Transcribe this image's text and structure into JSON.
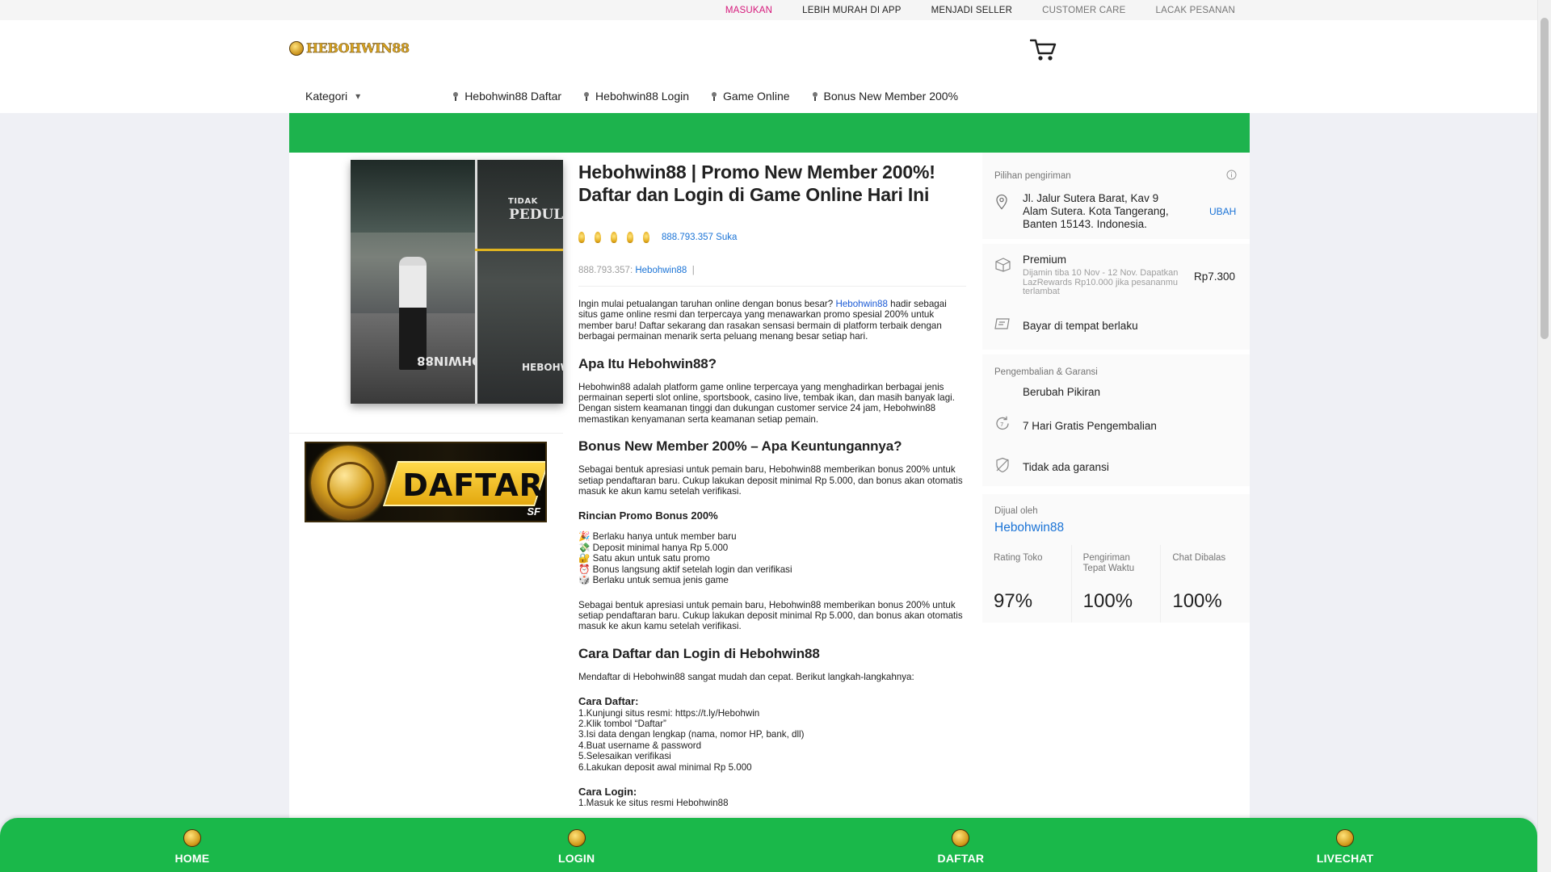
{
  "topbar": {
    "links": [
      {
        "label": "MASUKAN",
        "color": "#d6187b"
      },
      {
        "label": "LEBIH MURAH DI APP",
        "color": "#212121"
      },
      {
        "label": "MENJADI SELLER",
        "color": "#212121"
      },
      {
        "label": "CUSTOMER CARE",
        "color": "#757575"
      },
      {
        "label": "LACAK PESANAN",
        "color": "#757575"
      }
    ]
  },
  "header": {
    "logo_text": "HEBOHWIN88",
    "cart_icon": "cart-icon"
  },
  "nav": {
    "kategori": "Kategori",
    "items": [
      "Hebohwin88 Daftar",
      "Hebohwin88 Login",
      "Game Online",
      "Bonus New Member 200%"
    ]
  },
  "gallery": {
    "image_text_1": "TIDAK",
    "image_text_2": "PEDULI",
    "watermark": "HEBOHWIN88",
    "banner_label": "DAFTAR",
    "banner_corner": "SF"
  },
  "product": {
    "title_line1": "Hebohwin88 | Promo New Member 200%!",
    "title_line2": "Daftar dan Login di Game Online Hari Ini",
    "rating_stars": 5,
    "likes": "888.793.357 Suka",
    "byline_count": "888.793.357:",
    "byline_brand": "Hebohwin88",
    "byline_sep": "|",
    "intro_before": "Ingin mulai petualangan taruhan online dengan bonus besar?",
    "intro_link": "Hebohwin88",
    "intro_after": "hadir sebagai situs game online resmi dan terpercaya yang menawarkan promo spesial 200% untuk member baru! Daftar sekarang dan rasakan sensasi bermain di platform terbaik dengan berbagai permainan menarik serta peluang menang besar setiap hari.",
    "h_apa": "Apa Itu Hebohwin88?",
    "p_apa": "Hebohwin88 adalah platform game online terpercaya yang menghadirkan berbagai jenis permainan seperti slot online, sportsbook, casino live, tembak ikan, dan masih banyak lagi. Dengan sistem keamanan tinggi dan dukungan customer service 24 jam, Hebohwin88 memastikan kenyamanan serta keamanan setiap pemain.",
    "h_bonus": "Bonus New Member 200% – Apa Keuntungannya?",
    "p_bonus": "Sebagai bentuk apresiasi untuk pemain baru, Hebohwin88 memberikan bonus 200% untuk setiap pendaftaran baru. Cukup lakukan deposit minimal Rp 5.000, dan bonus akan otomatis masuk ke akun kamu setelah verifikasi.",
    "h_rincian": "Rincian Promo Bonus 200%",
    "rincian": [
      {
        "icon": "🎉",
        "text": "Berlaku hanya untuk member baru"
      },
      {
        "icon": "💸",
        "text": "Deposit minimal hanya Rp 5.000"
      },
      {
        "icon": "🔐",
        "text": "Satu akun untuk satu promo"
      },
      {
        "icon": "⏰",
        "text": "Bonus langsung aktif setelah login dan verifikasi"
      },
      {
        "icon": "🎲",
        "text": "Berlaku untuk semua jenis game"
      }
    ],
    "p_bonus2": "Sebagai bentuk apresiasi untuk pemain baru, Hebohwin88 memberikan bonus 200% untuk setiap pendaftaran baru. Cukup lakukan deposit minimal Rp 5.000, dan bonus akan otomatis masuk ke akun kamu setelah verifikasi.",
    "h_cara": "Cara Daftar dan Login di Hebohwin88",
    "p_cara": "Mendaftar di Hebohwin88 sangat mudah dan cepat. Berikut langkah-langkahnya:",
    "h_daftar": "Cara Daftar:",
    "daftar_steps": [
      "1.Kunjungi situs resmi: https://t.ly/Hebohwin",
      "2.Klik tombol “Daftar”",
      "3.Isi data dengan lengkap (nama, nomor HP, bank, dll)",
      "4.Buat username & password",
      "5.Selesaikan verifikasi",
      "6.Lakukan deposit awal minimal Rp 5.000"
    ],
    "h_login": "Cara Login:",
    "login_steps": [
      "1.Masuk ke situs resmi Hebohwin88"
    ]
  },
  "delivery": {
    "label": "Pilihan pengiriman",
    "address": "Jl. Jalur Sutera Barat, Kav 9 Alam Sutera. Kota Tangerang, Banten 15143. Indonesia.",
    "change": "UBAH",
    "premium_title": "Premium",
    "premium_sub": "Dijamin tiba 10 Nov - 12 Nov. Dapatkan LazRewards Rp10.000 jika pesananmu terlambat",
    "premium_price": "Rp7.300",
    "cod": "Bayar di tempat berlaku"
  },
  "returns": {
    "label": "Pengembalian & Garansi",
    "items": [
      "Berubah Pikiran",
      "7 Hari Gratis Pengembalian",
      "Tidak ada garansi"
    ]
  },
  "seller": {
    "label": "Dijual oleh",
    "name": "Hebohwin88",
    "stats": [
      {
        "label": "Rating Toko",
        "value": "97%"
      },
      {
        "label": "Pengiriman Tepat Waktu",
        "value": "100%"
      },
      {
        "label": "Chat Dibalas",
        "value": "100%"
      }
    ]
  },
  "bottom_nav": {
    "items": [
      "HOME",
      "LOGIN",
      "DAFTAR",
      "LIVECHAT"
    ]
  },
  "colors": {
    "green": "#1db34d",
    "link": "#1a73d6",
    "accent_pink": "#d6187b"
  }
}
